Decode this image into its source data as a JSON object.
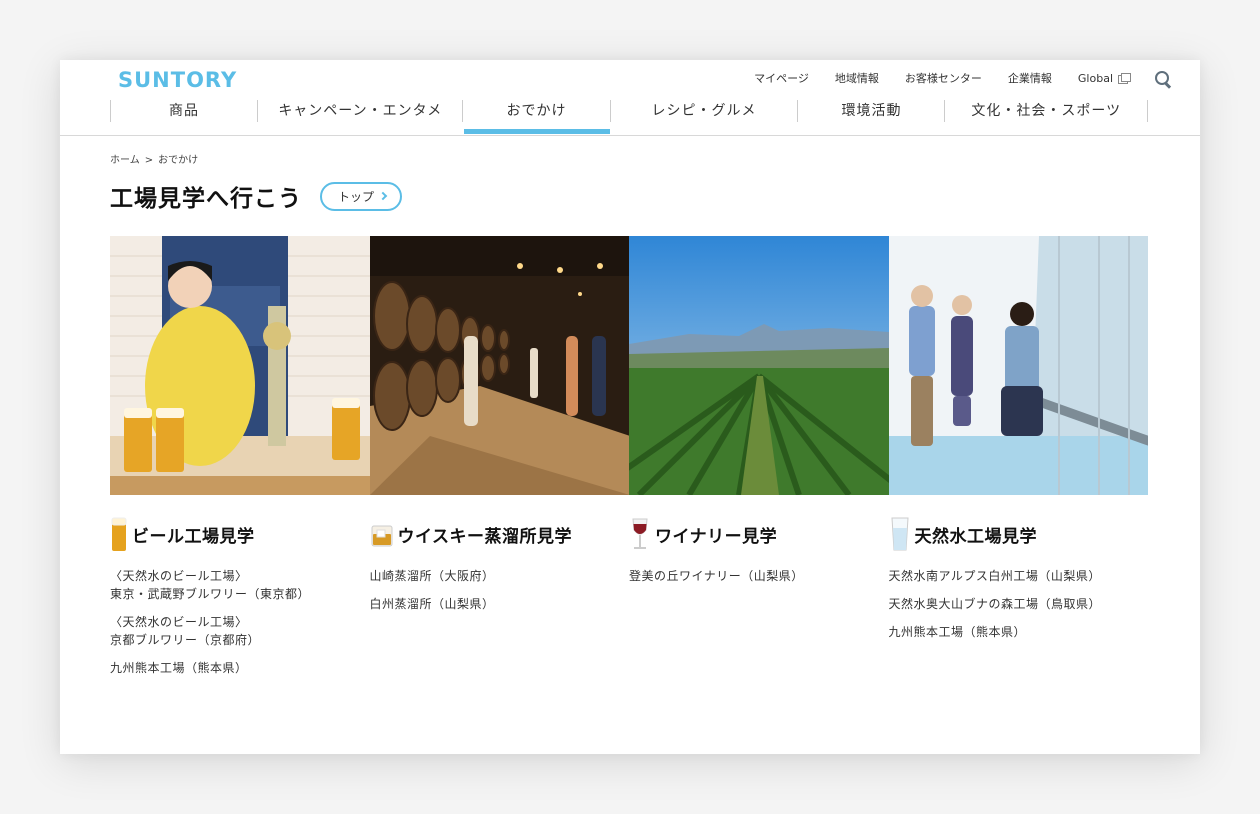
{
  "brand": {
    "logo_text": "SUNTORY",
    "accent_color": "#5bbde6"
  },
  "utility_nav": {
    "items": [
      "マイページ",
      "地域情報",
      "お客様センター",
      "企業情報",
      "Global"
    ],
    "search_icon": "search-icon"
  },
  "main_nav": {
    "items": [
      "商品",
      "キャンペーン・エンタメ",
      "おでかけ",
      "レシピ・グルメ",
      "環境活動",
      "文化・社会・スポーツ"
    ],
    "active": "おでかけ"
  },
  "breadcrumb": {
    "home": "ホーム",
    "separator": ">",
    "current": "おでかけ"
  },
  "page": {
    "title": "工場見学へ行こう",
    "top_button": "トップ"
  },
  "cards": [
    {
      "title": "ビール工場見学",
      "icon": "beer-glass-icon",
      "links": [
        {
          "line1": "〈天然水のビール工場〉",
          "line2": "東京・武蔵野ブルワリー（東京都）"
        },
        {
          "line1": "〈天然水のビール工場〉",
          "line2": "京都ブルワリー（京都府）"
        },
        {
          "line1": "九州熊本工場（熊本県）",
          "line2": ""
        }
      ]
    },
    {
      "title": "ウイスキー蒸溜所見学",
      "icon": "whisky-glass-icon",
      "links": [
        {
          "line1": "山崎蒸溜所（大阪府）",
          "line2": ""
        },
        {
          "line1": "白州蒸溜所（山梨県）",
          "line2": ""
        }
      ]
    },
    {
      "title": "ワイナリー見学",
      "icon": "wine-glass-icon",
      "links": [
        {
          "line1": "登美の丘ワイナリー（山梨県）",
          "line2": ""
        }
      ]
    },
    {
      "title": "天然水工場見学",
      "icon": "water-glass-icon",
      "links": [
        {
          "line1": "天然水南アルプス白州工場（山梨県）",
          "line2": ""
        },
        {
          "line1": "天然水奥大山ブナの森工場（鳥取県）",
          "line2": ""
        },
        {
          "line1": "九州熊本工場（熊本県）",
          "line2": ""
        }
      ]
    }
  ]
}
